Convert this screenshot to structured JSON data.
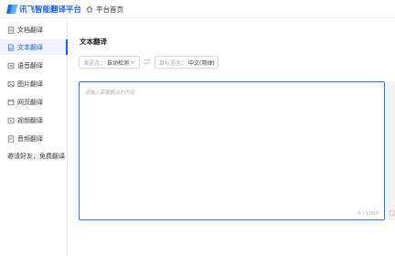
{
  "header": {
    "logo_text": "讯飞智能翻译平台",
    "home_label": "平台首页"
  },
  "sidebar": {
    "items": [
      {
        "label": "文档翻译",
        "icon": "document-icon"
      },
      {
        "label": "文本翻译",
        "icon": "text-document-icon",
        "active": true
      },
      {
        "label": "语音翻译",
        "icon": "audio-icon"
      },
      {
        "label": "图片翻译",
        "icon": "image-icon"
      },
      {
        "label": "网页翻译",
        "icon": "webpage-icon"
      },
      {
        "label": "视频翻译",
        "icon": "video-icon"
      },
      {
        "label": "音频翻译",
        "icon": "audio-file-icon"
      }
    ],
    "invite_label": "邀请好友，免费翻译"
  },
  "main": {
    "title": "文本翻译",
    "source_lang": {
      "label": "源语言：",
      "value": "自动检测"
    },
    "target_lang": {
      "label": "目标语言：",
      "value": "中文(简体)"
    },
    "input": {
      "placeholder": "请输入需要翻译的内容",
      "counter": "0 / 1000"
    }
  },
  "colors": {
    "accent": "#1a5ef0",
    "active_bg": "#eef4ff",
    "border": "#dcdcdc"
  }
}
